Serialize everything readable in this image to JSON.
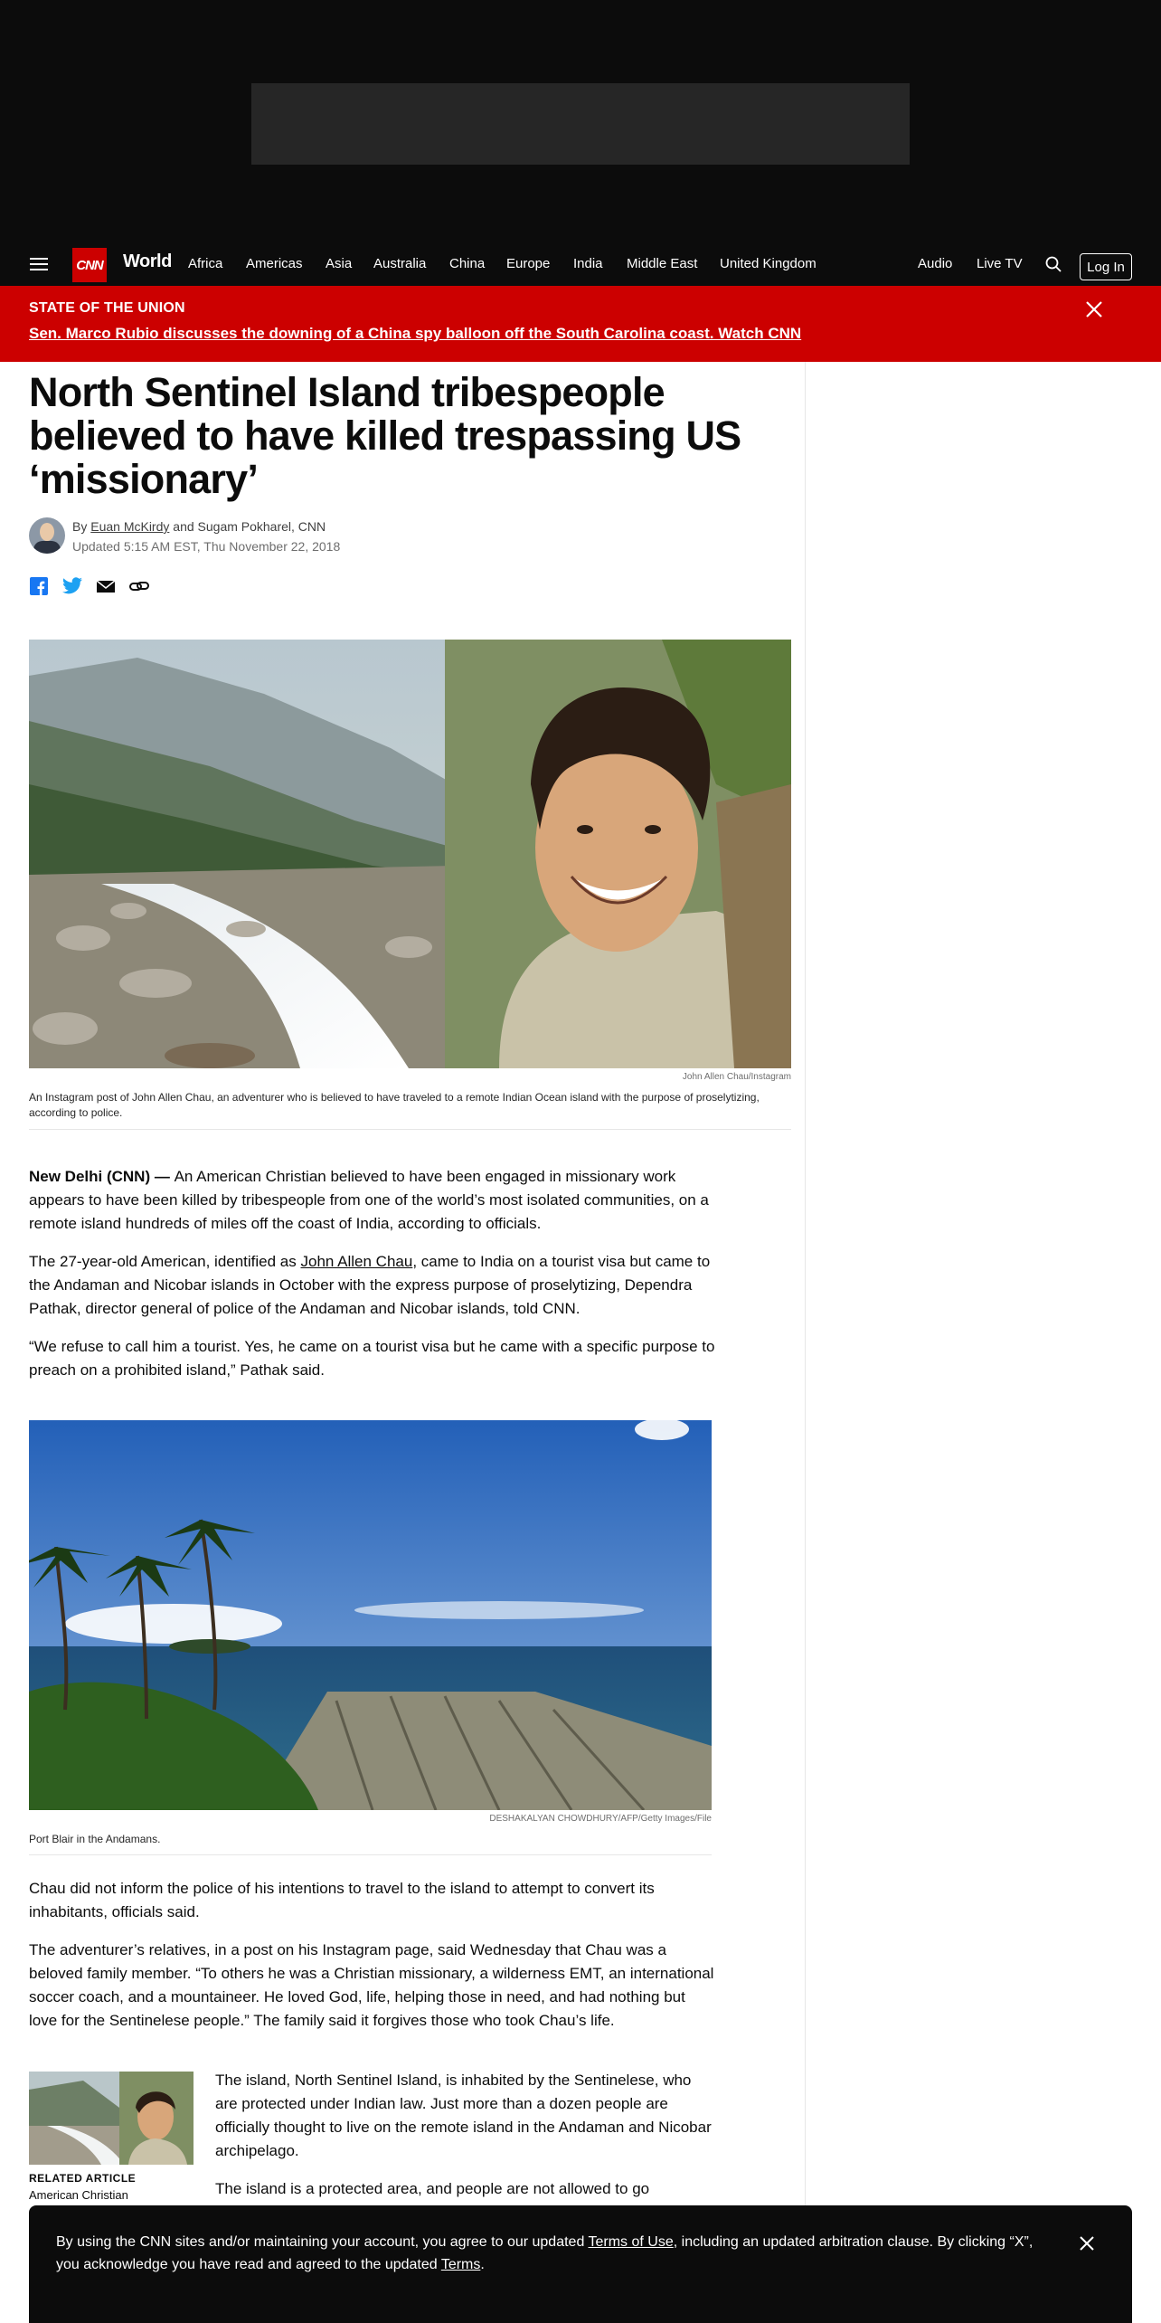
{
  "nav": {
    "logo": "CNN",
    "section": "World",
    "links": [
      "Africa",
      "Americas",
      "Asia",
      "Australia",
      "China",
      "Europe",
      "India",
      "Middle East",
      "United Kingdom"
    ],
    "audio": "Audio",
    "live_tv": "Live TV",
    "login": "Log In"
  },
  "banner": {
    "kicker": "STATE OF THE UNION",
    "headline": "Sen. Marco Rubio discusses the downing of a China spy balloon off the South Carolina coast. Watch CNN"
  },
  "article": {
    "title": "North Sentinel Island tribespeople believed to have killed trespassing US ‘missionary’",
    "byline_prefix": "By ",
    "author1": "Euan McKirdy",
    "byline_rest": " and Sugam Pokharel, CNN",
    "updated": "Updated 5:15 AM EST, Thu November 22, 2018",
    "image1": {
      "credit": "John Allen Chau/Instagram",
      "caption": "An Instagram post of John Allen Chau, an adventurer who is believed to have traveled to a remote Indian Ocean island with the purpose of proselytizing, according to police."
    },
    "p1_lead": "New Delhi (CNN) — ",
    "p1": "An American Christian believed to have been engaged in missionary work appears to have been killed by tribespeople from one of the world’s most isolated communities, on a remote island hundreds of miles off the coast of India, according to officials.",
    "p2_pre": "The 27-year-old American, identified as ",
    "p2_link": "John Allen Chau",
    "p2_post": ", came to India on a tourist visa but came to the Andaman and Nicobar islands in October with the express purpose of proselytizing, Dependra Pathak, director general of police of the Andaman and Nicobar islands, told CNN.",
    "p3": "“We refuse to call him a tourist. Yes, he came on a tourist visa but he came with a specific purpose to preach on a prohibited island,” Pathak said.",
    "image2": {
      "credit": "DESHAKALYAN CHOWDHURY/AFP/Getty Images/File",
      "caption": "Port Blair in the Andamans."
    },
    "p4": "Chau did not inform the police of his intentions to travel to the island to attempt to convert its inhabitants, officials said.",
    "p5": "The adventurer’s relatives, in a post on his Instagram page, said Wednesday that Chau was a beloved family member. “To others he was a Christian missionary, a wilderness EMT, an international soccer coach, and a mountaineer. He loved God, life, helping those in need, and had nothing but love for the Sentinelese people.” The family said it forgives those who took Chau’s life.",
    "related_label": "RELATED ARTICLE",
    "related_title": "American Christian",
    "p6": "The island, North Sentinel Island, is inhabited by the Sentinelese, who are protected under Indian law. Just more than a dozen people are officially thought to live on the remote island in the Andaman and Nicobar archipelago.",
    "p7": "The island is a protected area, and people are not allowed to go"
  },
  "cookie": {
    "t1": "By using the CNN sites and/or maintaining your account, you agree to our updated ",
    "link1": "Terms of Use",
    "t2": ", including an updated arbitration clause. By clicking “X”, you acknowledge you have read and agreed to the updated ",
    "link2": "Terms",
    "t3": "."
  }
}
